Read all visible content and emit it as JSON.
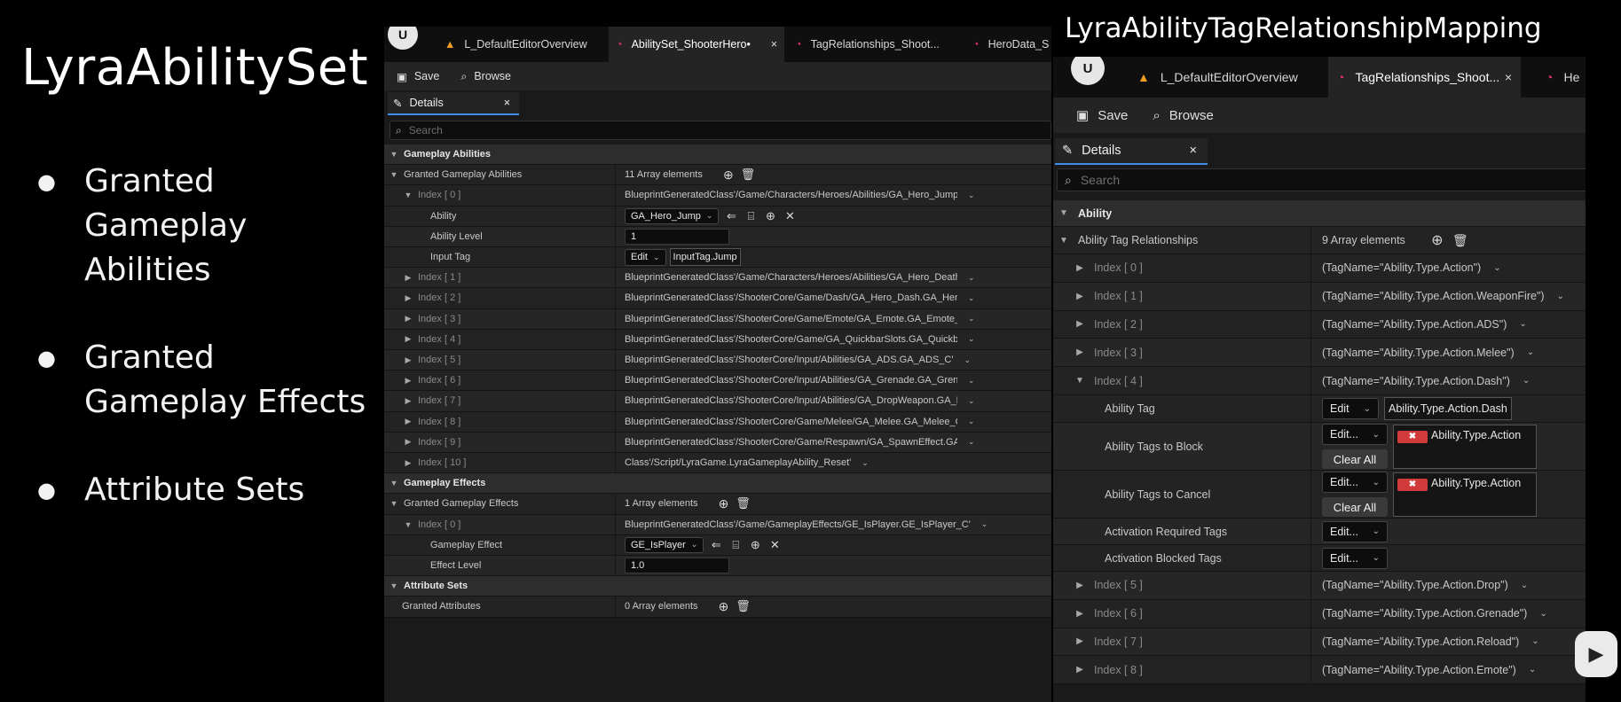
{
  "slide": {
    "title": "LyraAbilitySet",
    "bullets": [
      "Granted Gameplay Abilities",
      "Granted Gameplay Effects",
      "Attribute Sets"
    ]
  },
  "editor_a": {
    "tabs": [
      {
        "label": "L_DefaultEditorOverview",
        "icon": "level-icon"
      },
      {
        "label": "AbilitySet_ShooterHero•",
        "icon": "data-asset-icon",
        "active": true
      },
      {
        "label": "TagRelationships_Shoot...",
        "icon": "data-asset-icon"
      },
      {
        "label": "HeroData_S",
        "icon": "data-asset-icon"
      }
    ],
    "toolbar": {
      "save": "Save",
      "browse": "Browse"
    },
    "details_tab": "Details",
    "search_placeholder": "Search",
    "sections": {
      "abilities": "Gameplay Abilities",
      "effects": "Gameplay Effects",
      "attributes": "Attribute Sets"
    },
    "granted_abilities": {
      "label": "Granted Gameplay Abilities",
      "count": "11 Array elements",
      "items": [
        {
          "index": "Index [ 0 ]",
          "value": "BlueprintGeneratedClass'/Game/Characters/Heroes/Abilities/GA_Hero_Jump.GA_Hero_Jum"
        },
        {
          "index": "Index [ 1 ]",
          "value": "BlueprintGeneratedClass'/Game/Characters/Heroes/Abilities/GA_Hero_Death.GA_Hero_Dea"
        },
        {
          "index": "Index [ 2 ]",
          "value": "BlueprintGeneratedClass'/ShooterCore/Game/Dash/GA_Hero_Dash.GA_Hero_Dash_C'"
        },
        {
          "index": "Index [ 3 ]",
          "value": "BlueprintGeneratedClass'/ShooterCore/Game/Emote/GA_Emote.GA_Emote_C'"
        },
        {
          "index": "Index [ 4 ]",
          "value": "BlueprintGeneratedClass'/ShooterCore/Game/GA_QuickbarSlots.GA_QuickbarSlots_C'"
        },
        {
          "index": "Index [ 5 ]",
          "value": "BlueprintGeneratedClass'/ShooterCore/Input/Abilities/GA_ADS.GA_ADS_C'"
        },
        {
          "index": "Index [ 6 ]",
          "value": "BlueprintGeneratedClass'/ShooterCore/Input/Abilities/GA_Grenade.GA_Grenade_C'"
        },
        {
          "index": "Index [ 7 ]",
          "value": "BlueprintGeneratedClass'/ShooterCore/Input/Abilities/GA_DropWeapon.GA_DropWeapon_C'"
        },
        {
          "index": "Index [ 8 ]",
          "value": "BlueprintGeneratedClass'/ShooterCore/Game/Melee/GA_Melee.GA_Melee_C'"
        },
        {
          "index": "Index [ 9 ]",
          "value": "BlueprintGeneratedClass'/ShooterCore/Game/Respawn/GA_SpawnEffect.GA_SpawnEffect_C"
        },
        {
          "index": "Index [ 10 ]",
          "value": "Class'/Script/LyraGame.LyraGameplayAbility_Reset'"
        }
      ],
      "expanded": {
        "ability_label": "Ability",
        "ability_value": "GA_Hero_Jump",
        "level_label": "Ability Level",
        "level_value": "1",
        "input_tag_label": "Input Tag",
        "edit": "Edit",
        "input_tag_value": "InputTag.Jump"
      }
    },
    "granted_effects": {
      "label": "Granted Gameplay Effects",
      "count": "1 Array elements",
      "item_index": "Index [ 0 ]",
      "item_value": "BlueprintGeneratedClass'/Game/GameplayEffects/GE_IsPlayer.GE_IsPlayer_C'",
      "effect_label": "Gameplay Effect",
      "effect_value": "GE_IsPlayer",
      "level_label": "Effect Level",
      "level_value": "1.0"
    },
    "granted_attributes": {
      "label": "Granted Attributes",
      "count": "0 Array elements"
    }
  },
  "editor_b": {
    "title": "LyraAbilityTagRelationshipMapping",
    "tabs": [
      {
        "label": "L_DefaultEditorOverview",
        "icon": "level-icon"
      },
      {
        "label": "TagRelationships_Shoot...",
        "icon": "data-asset-icon",
        "active": true
      },
      {
        "label": "He",
        "icon": "data-asset-icon"
      }
    ],
    "toolbar": {
      "save": "Save",
      "browse": "Browse"
    },
    "details_tab": "Details",
    "search_placeholder": "Search",
    "section": "Ability",
    "relationships": {
      "label": "Ability Tag Relationships",
      "count": "9 Array elements",
      "items": [
        {
          "index": "Index [ 0 ]",
          "value": "(TagName=\"Ability.Type.Action\")"
        },
        {
          "index": "Index [ 1 ]",
          "value": "(TagName=\"Ability.Type.Action.WeaponFire\")"
        },
        {
          "index": "Index [ 2 ]",
          "value": "(TagName=\"Ability.Type.Action.ADS\")"
        },
        {
          "index": "Index [ 3 ]",
          "value": "(TagName=\"Ability.Type.Action.Melee\")"
        },
        {
          "index": "Index [ 4 ]",
          "value": "(TagName=\"Ability.Type.Action.Dash\")"
        },
        {
          "index": "Index [ 5 ]",
          "value": "(TagName=\"Ability.Type.Action.Drop\")"
        },
        {
          "index": "Index [ 6 ]",
          "value": "(TagName=\"Ability.Type.Action.Grenade\")"
        },
        {
          "index": "Index [ 7 ]",
          "value": "(TagName=\"Ability.Type.Action.Reload\")"
        },
        {
          "index": "Index [ 8 ]",
          "value": "(TagName=\"Ability.Type.Action.Emote\")"
        }
      ],
      "expanded": {
        "ability_tag_label": "Ability Tag",
        "edit": "Edit",
        "ability_tag_value": "Ability.Type.Action.Dash",
        "block_label": "Ability Tags to Block",
        "edit_more": "Edit...",
        "block_tag": "Ability.Type.Action",
        "clear_all": "Clear All",
        "cancel_label": "Ability Tags to Cancel",
        "cancel_tag": "Ability.Type.Action",
        "required_label": "Activation Required Tags",
        "blocked_label": "Activation Blocked Tags"
      }
    }
  }
}
